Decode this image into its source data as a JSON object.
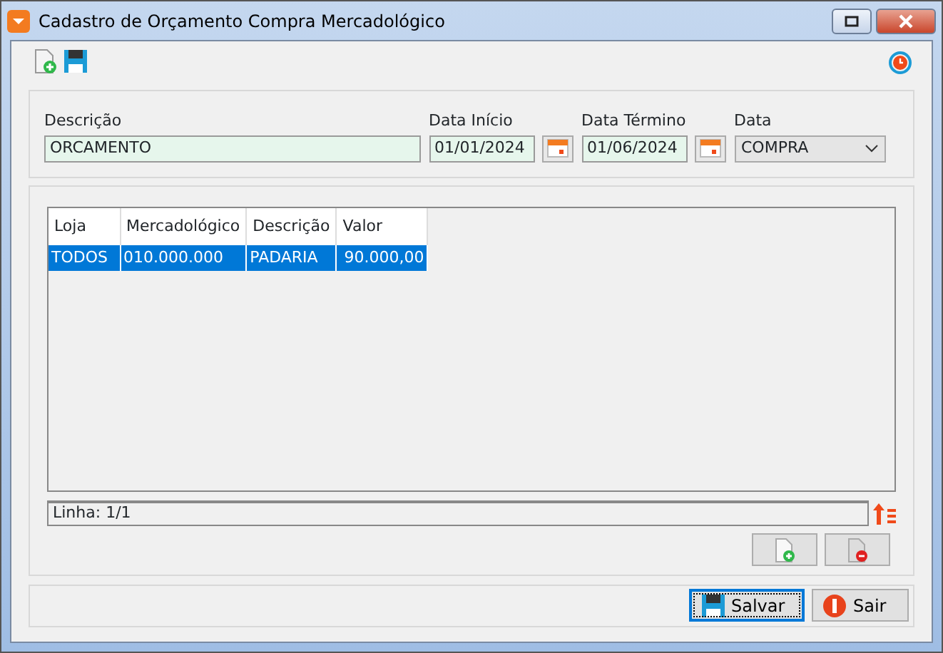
{
  "window": {
    "title": "Cadastro de Orçamento Compra Mercadológico"
  },
  "filters": [
    {
      "label": "Descrição",
      "value": "ORCAMENTO",
      "kind": "text"
    },
    {
      "label": "Data Início",
      "value": "01/01/2024",
      "kind": "date"
    },
    {
      "label": "Data Término",
      "value": "01/06/2024",
      "kind": "date"
    },
    {
      "label": "Data",
      "value": "COMPRA",
      "kind": "select"
    }
  ],
  "table": {
    "columns": [
      "Loja",
      "Mercadológico",
      "Descrição",
      "Valor"
    ],
    "rows": [
      {
        "cells": [
          "TODOS",
          "010.000.000",
          "PADARIA",
          "90.000,00"
        ],
        "selected": true
      }
    ]
  },
  "status_bar": "Linha: 1/1",
  "buttons": [
    "Salvar",
    "Sair"
  ]
}
